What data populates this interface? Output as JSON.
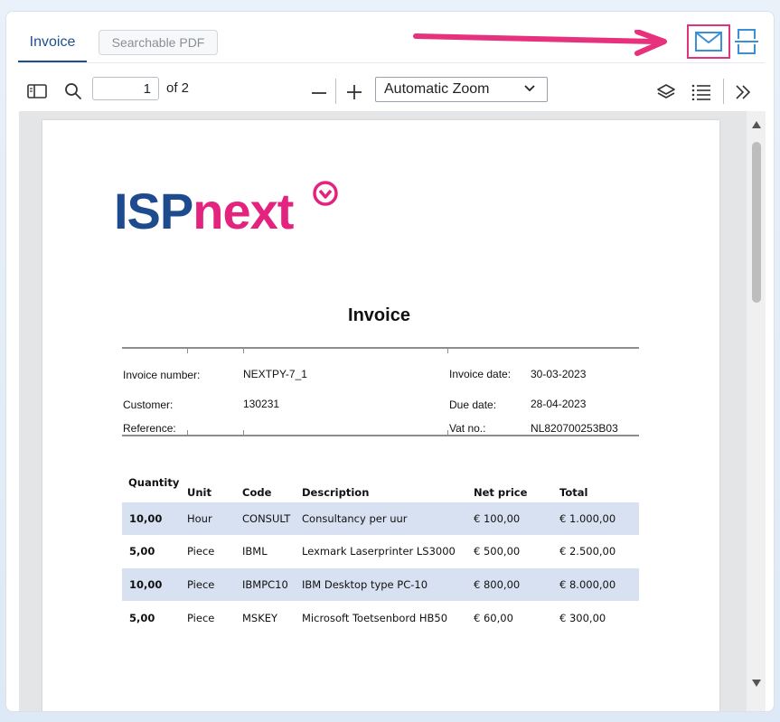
{
  "tabs": [
    {
      "label": "Invoice"
    },
    {
      "label": "Searchable PDF"
    }
  ],
  "toolbar": {
    "page_value": "1",
    "page_of": "of 2",
    "zoom": "Automatic Zoom"
  },
  "icons": {
    "sidebar": "sidebar-toggle-icon",
    "search": "search-icon",
    "zoom_out": "minus-icon",
    "zoom_in": "plus-icon",
    "layers": "layers-icon",
    "outline": "list-icon",
    "tools": "double-chevron-right-icon",
    "mail": "mail-icon",
    "split": "split-page-icon"
  },
  "colors": {
    "accent": "#1e4f8f",
    "highlight": "#e0337f",
    "icon_blue": "#3a8fd8",
    "row_shade": "#d8e1f1"
  },
  "document": {
    "logo_part1": "ISP",
    "logo_part2": "next",
    "title": "Invoice",
    "invoice_number_label": "Invoice number:",
    "invoice_number": "NEXTPY-7_1",
    "invoice_date_label": "Invoice date:",
    "invoice_date": "30-03-2023",
    "customer_label": "Customer:",
    "customer": "130231",
    "due_date_label": "Due date:",
    "due_date": "28-04-2023",
    "reference_label": "Reference:",
    "vat_label": "Vat no.:",
    "vat": "NL820700253B03",
    "headers": [
      "Quantity",
      "Unit",
      "Code",
      "Description",
      "Net price",
      "Total"
    ],
    "items": [
      [
        "10,00",
        "Hour",
        "CONSULT",
        "Consultancy per uur",
        "€ 100,00",
        "€ 1.000,00"
      ],
      [
        "5,00",
        "Piece",
        "IBML",
        "Lexmark Laserprinter LS3000",
        "€ 500,00",
        "€ 2.500,00"
      ],
      [
        "10,00",
        "Piece",
        "IBMPC10",
        "IBM Desktop type PC-10",
        "€ 800,00",
        "€ 8.000,00"
      ],
      [
        "5,00",
        "Piece",
        "MSKEY",
        "Microsoft Toetsenbord HB50",
        "€ 60,00",
        "€ 300,00"
      ]
    ]
  }
}
